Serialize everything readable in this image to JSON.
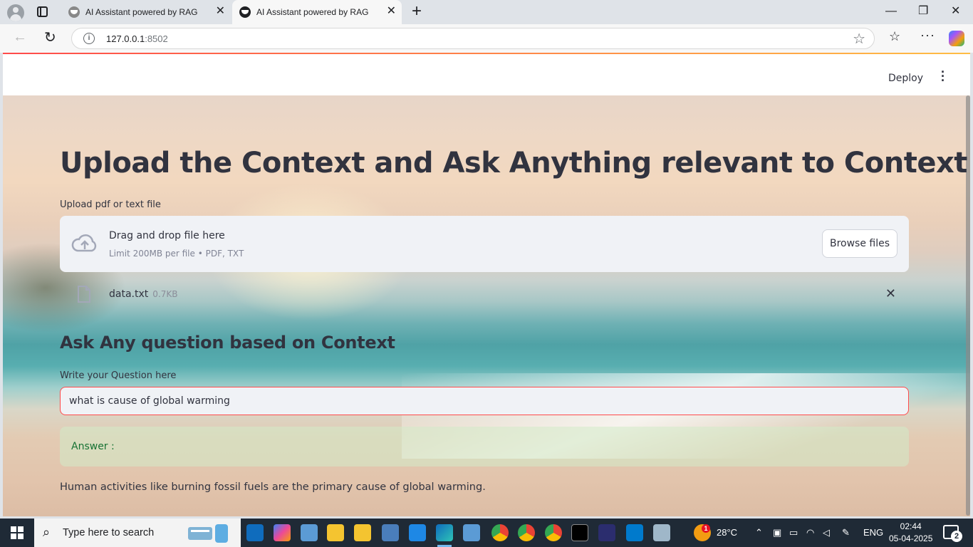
{
  "browser": {
    "tabs": [
      {
        "title": "AI Assistant powered by RAG"
      },
      {
        "title": "AI Assistant powered by RAG"
      }
    ],
    "url_host": "127.0.0.1",
    "url_port": ":8502",
    "info_glyph": "i"
  },
  "header": {
    "deploy_label": "Deploy"
  },
  "main": {
    "title": "Upload the Context and Ask Anything relevant to Context",
    "upload_label": "Upload pdf or text file",
    "dropzone_title": "Drag and drop file here",
    "dropzone_limit": "Limit 200MB per file • PDF, TXT",
    "browse_label": "Browse files",
    "file": {
      "name": "data.txt",
      "size": "0.7KB"
    },
    "question_heading": "Ask Any question based on Context",
    "question_label": "Write your Question here",
    "question_value": "what is cause of global warming",
    "answer_label": "Answer :",
    "answer_text": "Human activities like burning fossil fuels are the primary cause of global warming."
  },
  "taskbar": {
    "search_placeholder": "Type here to search",
    "weather": "28°C",
    "weather_badge": "1",
    "language": "ENG",
    "time": "02:44",
    "date": "05-04-2025",
    "notification_count": "2"
  },
  "colors": {
    "accent": "#ff4b4b",
    "answer_text": "#177233",
    "taskbar": "#1f2a36"
  },
  "icons": [
    "profile-icon",
    "tab-actions-icon",
    "back-icon",
    "reload-icon",
    "info-icon",
    "star-icon",
    "favorites-icon",
    "more-icon",
    "copilot-icon",
    "cloud-upload-icon",
    "file-icon",
    "close-icon",
    "windows-start-icon",
    "search-icon"
  ]
}
